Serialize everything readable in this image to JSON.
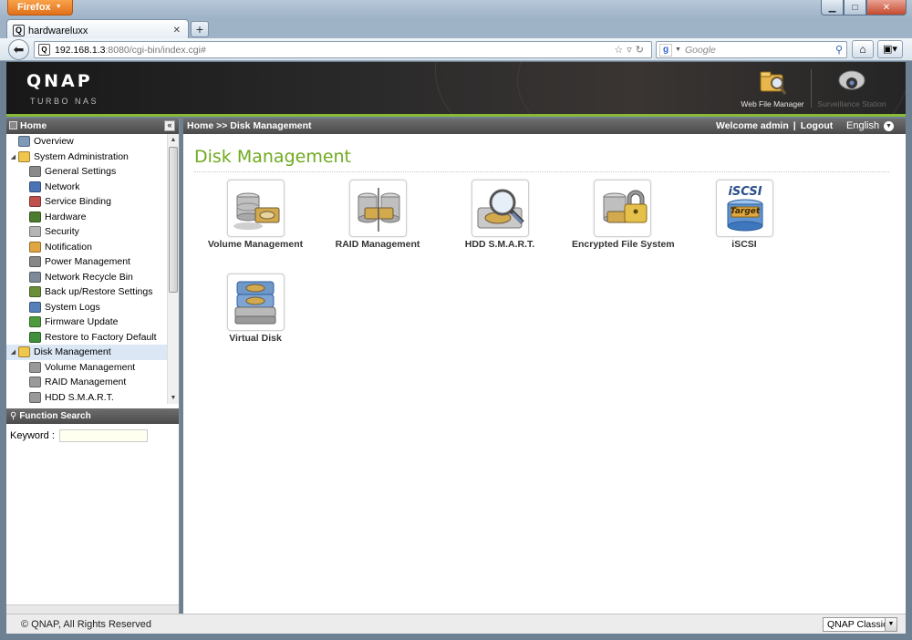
{
  "browser": {
    "menu_label": "Firefox",
    "tab_title": "hardwareluxx",
    "url_host": "192.168.1.3",
    "url_path": ":8080/cgi-bin/index.cgi#",
    "search_placeholder": "Google",
    "new_tab": "+"
  },
  "qnap": {
    "logo": "QNAP",
    "subtitle": "TURBO NAS",
    "apps": [
      {
        "label": "Web File Manager"
      },
      {
        "label": "Surveillance Station"
      }
    ]
  },
  "sidebar": {
    "home_label": "Home",
    "collapse": "«",
    "tree": [
      {
        "label": "Overview",
        "level": 0,
        "icon": "overview-icon",
        "color": "#7f9ab8"
      },
      {
        "label": "System Administration",
        "level": 0,
        "icon": "folder-icon",
        "color": "#f1c64d",
        "expanded": true
      },
      {
        "label": "General Settings",
        "level": 1,
        "icon": "general-settings-icon",
        "color": "#8a8a8a"
      },
      {
        "label": "Network",
        "level": 1,
        "icon": "network-icon",
        "color": "#4b74b7"
      },
      {
        "label": "Service Binding",
        "level": 1,
        "icon": "service-binding-icon",
        "color": "#c0504d"
      },
      {
        "label": "Hardware",
        "level": 1,
        "icon": "hardware-icon",
        "color": "#4c7d2f"
      },
      {
        "label": "Security",
        "level": 1,
        "icon": "lock-icon",
        "color": "#b5b5b5"
      },
      {
        "label": "Notification",
        "level": 1,
        "icon": "notification-icon",
        "color": "#e0a640"
      },
      {
        "label": "Power Management",
        "level": 1,
        "icon": "power-icon",
        "color": "#888888"
      },
      {
        "label": "Network Recycle Bin",
        "level": 1,
        "icon": "recycle-bin-icon",
        "color": "#7d8b99"
      },
      {
        "label": "Back up/Restore Settings",
        "level": 1,
        "icon": "backup-icon",
        "color": "#6b8e3a"
      },
      {
        "label": "System Logs",
        "level": 1,
        "icon": "logs-icon",
        "color": "#5580b8"
      },
      {
        "label": "Firmware Update",
        "level": 1,
        "icon": "firmware-icon",
        "color": "#4f9a3c"
      },
      {
        "label": "Restore to Factory Default",
        "level": 1,
        "icon": "restore-icon",
        "color": "#3f8f3b"
      },
      {
        "label": "Disk Management",
        "level": 0,
        "icon": "folder-icon",
        "color": "#f1c64d",
        "expanded": true,
        "selected": true
      },
      {
        "label": "Volume Management",
        "level": 1,
        "icon": "volume-icon",
        "color": "#999999"
      },
      {
        "label": "RAID Management",
        "level": 1,
        "icon": "raid-icon",
        "color": "#999999"
      },
      {
        "label": "HDD S.M.A.R.T.",
        "level": 1,
        "icon": "hdd-smart-icon",
        "color": "#999999"
      }
    ],
    "function_search_label": "Function Search",
    "keyword_label": "Keyword :"
  },
  "content": {
    "breadcrumb": "Home >> Disk Management",
    "welcome": "Welcome admin",
    "logout": "Logout",
    "language": "English",
    "page_title": "Disk Management",
    "apps": [
      {
        "label": "Volume Management",
        "icon": "volume-management-icon"
      },
      {
        "label": "RAID Management",
        "icon": "raid-management-icon"
      },
      {
        "label": "HDD S.M.A.R.T.",
        "icon": "hdd-smart-icon"
      },
      {
        "label": "Encrypted File System",
        "icon": "encrypted-fs-icon"
      },
      {
        "label": "iSCSI",
        "icon": "iscsi-icon",
        "badge_top": "iSCSI",
        "badge_mid": "Target"
      },
      {
        "label": "Virtual Disk",
        "icon": "virtual-disk-icon"
      }
    ]
  },
  "footer": {
    "copyright": "© QNAP, All Rights Reserved",
    "theme": "QNAP Classic"
  }
}
